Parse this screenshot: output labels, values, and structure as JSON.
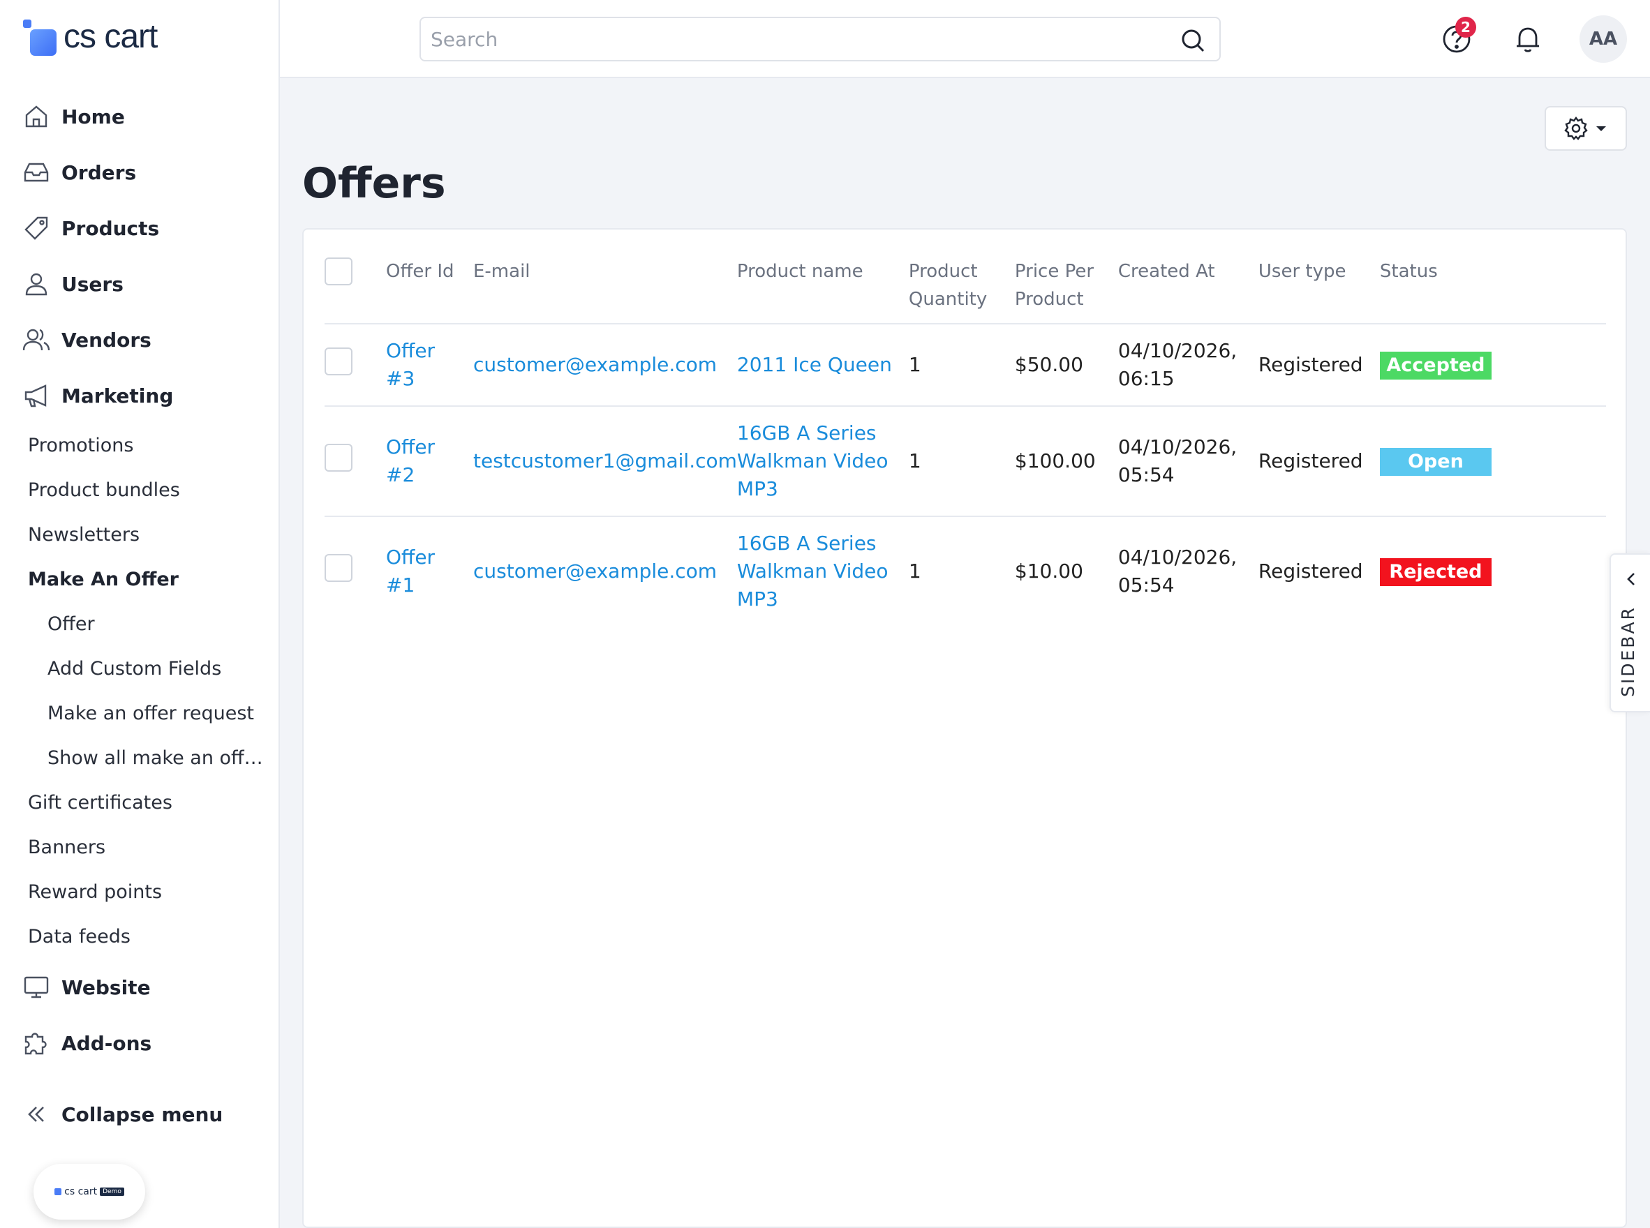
{
  "brand": {
    "name": "cs cart",
    "badge_name": "cs cart",
    "badge_tag": "Demo"
  },
  "colors": {
    "link": "#1a8cdb",
    "accepted": "#4cd964",
    "open": "#5ac8f0",
    "rejected": "#f2131e",
    "badge": "#e0264a"
  },
  "nav": {
    "home": "Home",
    "orders": "Orders",
    "products": "Products",
    "users": "Users",
    "vendors": "Vendors",
    "marketing": "Marketing",
    "marketing_items": [
      "Promotions",
      "Product bundles",
      "Newsletters",
      "Make An Offer"
    ],
    "make_offer_items": [
      "Offer",
      "Add Custom Fields",
      "Make an offer request",
      "Show all make an offer requests"
    ],
    "marketing_items_after": [
      "Gift certificates",
      "Banners",
      "Reward points",
      "Data feeds"
    ],
    "website": "Website",
    "addons": "Add-ons",
    "collapse": "Collapse menu"
  },
  "header": {
    "search_placeholder": "Search",
    "help_count": "2",
    "avatar_initials": "AA"
  },
  "page": {
    "title": "Offers"
  },
  "table": {
    "columns": {
      "offer_id": "Offer Id",
      "email": "E-mail",
      "product_name": "Product name",
      "quantity": "Product Quantity",
      "price": "Price Per Product",
      "created": "Created At",
      "user_type": "User type",
      "status": "Status"
    },
    "rows": [
      {
        "offer": "Offer #3",
        "email": "customer@example.com",
        "product": "2011 Ice Queen",
        "qty": "1",
        "price": "$50.00",
        "created": "04/10/2026, 06:15",
        "user_type": "Registered",
        "status": "Accepted"
      },
      {
        "offer": "Offer #2",
        "email": "testcustomer1@gmail.com",
        "product": "16GB A Series Walkman Video MP3",
        "qty": "1",
        "price": "$100.00",
        "created": "04/10/2026, 05:54",
        "user_type": "Registered",
        "status": "Open"
      },
      {
        "offer": "Offer #1",
        "email": "customer@example.com",
        "product": "16GB A Series Walkman Video MP3",
        "qty": "1",
        "price": "$10.00",
        "created": "04/10/2026, 05:54",
        "user_type": "Registered",
        "status": "Rejected"
      }
    ]
  },
  "sidebar_tab": {
    "label": "SIDEBAR"
  }
}
